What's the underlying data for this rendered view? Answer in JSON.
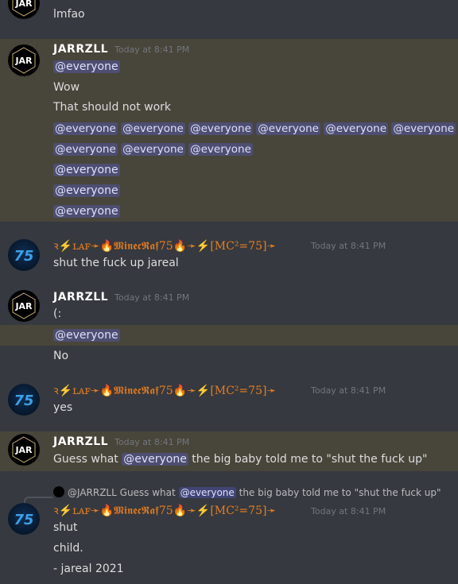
{
  "messages": [
    {
      "top_text": "lmfao"
    },
    {
      "username": "JARRZLL",
      "timestamp": "Today at 8:41 PM",
      "lines": [
        "@everyone",
        "Wow",
        "That should not work"
      ]
    },
    {
      "mass_mentions": [
        "@everyone",
        "@everyone",
        "@everyone",
        "@everyone",
        "@everyone",
        "@everyone"
      ],
      "mass_mentions_2": [
        "@everyone",
        "@everyone",
        "@everyone"
      ],
      "single_lines": [
        "@everyone",
        "@everyone",
        "@everyone"
      ]
    },
    {
      "username": "ꝛ⚡ʟᴀꜰ➛🔥𝕸𝖎𝖓𝖊𝖈𝕽𝖆𝖋75🔥➛⚡[MC²=75]➛",
      "timestamp": "Today at 8:41 PM",
      "lines": [
        "shut the fuck up jareal"
      ]
    },
    {
      "username": "JARRZLL",
      "timestamp": "Today at 8:41 PM",
      "lines": [
        "(:",
        "@everyone",
        "No"
      ]
    },
    {
      "username": "ꝛ⚡ʟᴀꜰ➛🔥𝕸𝖎𝖓𝖊𝖈𝕽𝖆𝖋75🔥➛⚡[MC²=75]➛",
      "timestamp": "Today at 8:41 PM",
      "lines": [
        "yes"
      ]
    },
    {
      "username": "JARRZLL",
      "timestamp": "Today at 8:41 PM",
      "line_pre": "Guess what",
      "line_mention": "@everyone",
      "line_post": "the big baby told me to \"shut the fuck up\""
    },
    {
      "reply_user": "@JARRZLL",
      "reply_pre": "Guess what",
      "reply_mention": "@everyone",
      "reply_post": "the big baby told me to \"shut the fuck up\"",
      "username": "ꝛ⚡ʟᴀꜰ➛🔥𝕸𝖎𝖓𝖊𝖈𝕽𝖆𝖋75🔥➛⚡[MC²=75]➛",
      "timestamp": "Today at 8:41 PM",
      "lines": [
        "shut",
        "child.",
        "- jareal 2021"
      ]
    }
  ],
  "avatars": {
    "jar_text": "JAR",
    "raf_text": "75"
  },
  "colors": {
    "background": "#36393f",
    "highlight": "#48453a",
    "mention_bg": "#4e538a",
    "raf_name": "#e67e22"
  }
}
